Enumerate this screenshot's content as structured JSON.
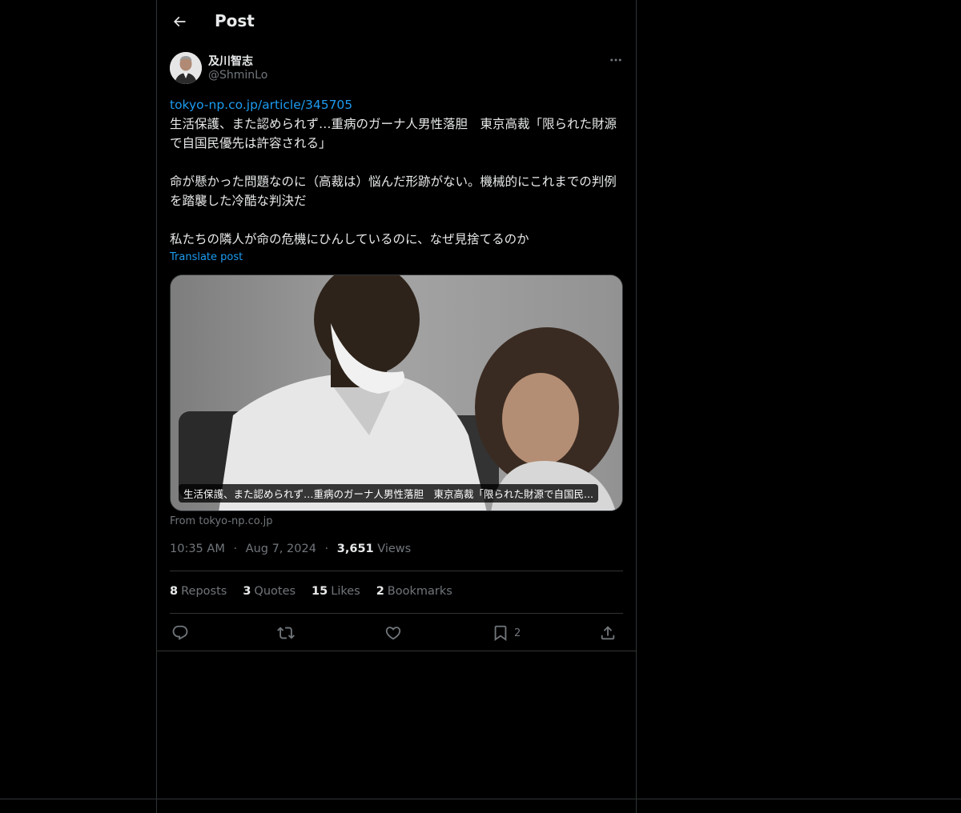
{
  "header": {
    "title": "Post"
  },
  "author": {
    "display_name": "及川智志",
    "handle": "@ShminLo"
  },
  "post": {
    "link": "tokyo-np.co.jp/article/345705",
    "paragraphs": [
      "生活保護、また認められず…重病のガーナ人男性落胆　東京高裁「限られた財源で自国民優先は許容される」",
      "命が懸かった問題なのに（高裁は）悩んだ形跡がない。機械的にこれまでの判例を踏襲した冷酷な判決だ",
      "私たちの隣人が命の危機にひんしているのに、なぜ見捨てるのか"
    ],
    "translate_label": "Translate post"
  },
  "media": {
    "caption": "生活保護、また認められず…重病のガーナ人男性落胆　東京高裁「限られた財源で自国民...",
    "from": "From tokyo-np.co.jp"
  },
  "meta": {
    "time": "10:35 AM",
    "date": "Aug 7, 2024",
    "views_count": "3,651",
    "views_label": "Views",
    "separator": "·"
  },
  "stats": [
    {
      "count": "8",
      "label": "Reposts"
    },
    {
      "count": "3",
      "label": "Quotes"
    },
    {
      "count": "15",
      "label": "Likes"
    },
    {
      "count": "2",
      "label": "Bookmarks"
    }
  ],
  "actions": {
    "reply_icon": "reply-icon",
    "repost_icon": "repost-icon",
    "like_icon": "heart-icon",
    "bookmark_icon": "bookmark-icon",
    "bookmark_count": "2",
    "share_icon": "share-icon"
  },
  "colors": {
    "background": "#000000",
    "text": "#e7e9ea",
    "secondary": "#71767b",
    "link": "#1d9bf0",
    "border": "#2f3336"
  }
}
